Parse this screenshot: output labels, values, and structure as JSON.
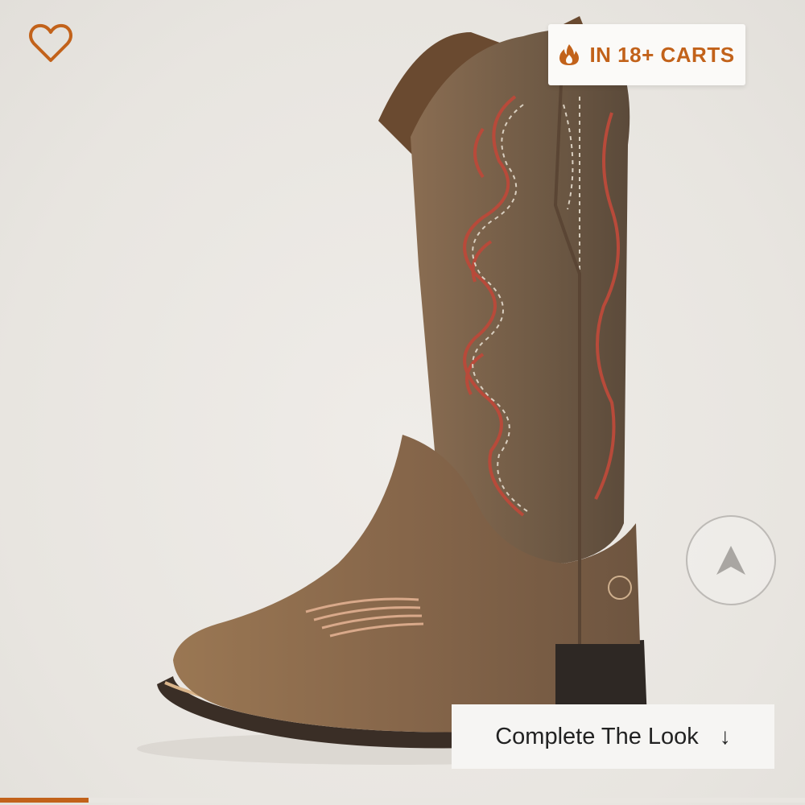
{
  "badge": {
    "text": "IN 18+ CARTS",
    "icon": "fire-icon",
    "color": "#c2621a"
  },
  "wishlist": {
    "icon": "heart-outline-icon",
    "color": "#c2621a"
  },
  "scroll_button": {
    "icon": "navigation-arrow-icon"
  },
  "complete_look": {
    "label": "Complete The Look",
    "icon": "down-arrow-icon",
    "arrow": "↓"
  },
  "image_carousel": {
    "progress": 0.11,
    "accent": "#c2621a"
  },
  "product_image": {
    "subject": "cowboy-boot-icon"
  }
}
